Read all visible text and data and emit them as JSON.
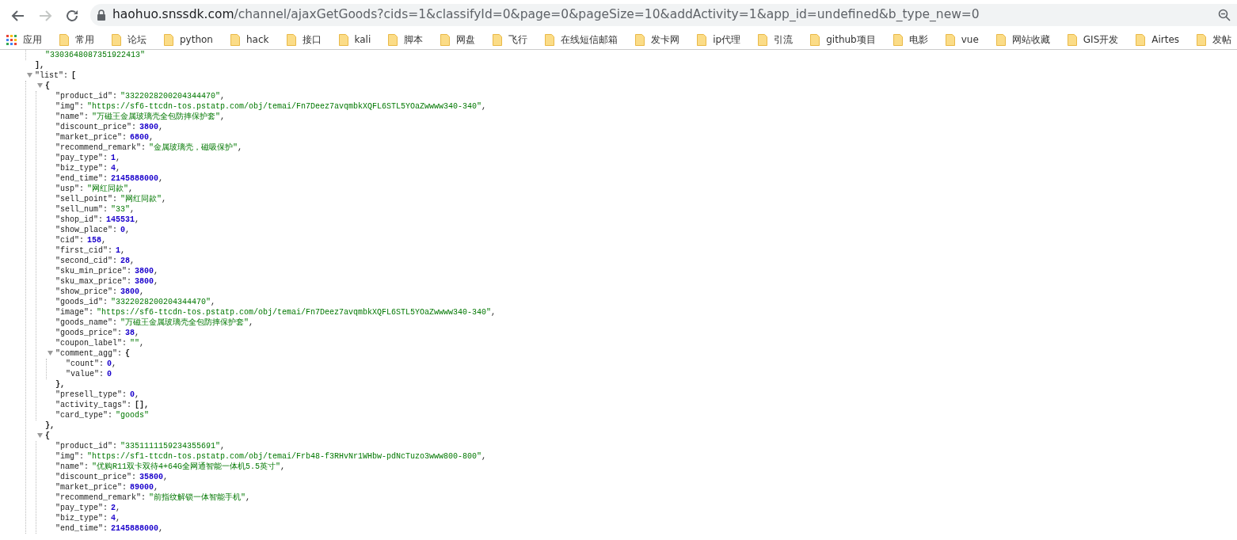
{
  "toolbar": {
    "address_host": "haohuo.snssdk.com",
    "address_path": "/channel/ajaxGetGoods?cids=1&classifyId=0&page=0&pageSize=10&addActivity=1&app_id=undefined&b_type_new=0"
  },
  "bookmarks": [
    {
      "label": "应用",
      "kind": "apps"
    },
    {
      "label": "常用",
      "kind": "folder"
    },
    {
      "label": "论坛",
      "kind": "folder"
    },
    {
      "label": "python",
      "kind": "folder"
    },
    {
      "label": "hack",
      "kind": "folder"
    },
    {
      "label": "接口",
      "kind": "folder"
    },
    {
      "label": "kali",
      "kind": "folder"
    },
    {
      "label": "脚本",
      "kind": "folder"
    },
    {
      "label": "网盘",
      "kind": "folder"
    },
    {
      "label": "飞行",
      "kind": "folder"
    },
    {
      "label": "在线短信邮箱",
      "kind": "folder"
    },
    {
      "label": "发卡网",
      "kind": "folder"
    },
    {
      "label": "ip代理",
      "kind": "folder"
    },
    {
      "label": "引流",
      "kind": "folder"
    },
    {
      "label": "github项目",
      "kind": "folder"
    },
    {
      "label": "电影",
      "kind": "folder"
    },
    {
      "label": "vue",
      "kind": "folder"
    },
    {
      "label": "网站收藏",
      "kind": "folder"
    },
    {
      "label": "GIS开发",
      "kind": "folder"
    },
    {
      "label": "Airtes",
      "kind": "folder"
    },
    {
      "label": "发帖",
      "kind": "folder"
    }
  ],
  "json_view": {
    "lines": [
      {
        "children": [
          {
            "value": "\"3303648087351922413\"",
            "kind": "string"
          }
        ],
        "close": "],"
      },
      {
        "key": "\"list\":",
        "value": "[",
        "kind": "bracket",
        "expanded": true,
        "children": [
          {
            "value": "{",
            "kind": "bracket",
            "expanded": true,
            "close": "},",
            "children": [
              {
                "key": "\"product_id\":",
                "value": "\"3322028200204344470\"",
                "kind": "string",
                "punct": ","
              },
              {
                "key": "\"img\":",
                "value": "\"https://sf6-ttcdn-tos.pstatp.com/obj/temai/Fn7Deez7avqmbkXQFL6STL5YOaZwwww340-340\"",
                "kind": "string",
                "punct": ","
              },
              {
                "key": "\"name\":",
                "value": "\"万磁王金属玻璃壳全包防摔保护套\"",
                "kind": "string",
                "punct": ","
              },
              {
                "key": "\"discount_price\":",
                "value": "3800",
                "kind": "number",
                "punct": ","
              },
              {
                "key": "\"market_price\":",
                "value": "6800",
                "kind": "number",
                "punct": ","
              },
              {
                "key": "\"recommend_remark\":",
                "value": "\"金属玻璃壳，磁吸保护\"",
                "kind": "string",
                "punct": ","
              },
              {
                "key": "\"pay_type\":",
                "value": "1",
                "kind": "number",
                "punct": ","
              },
              {
                "key": "\"biz_type\":",
                "value": "4",
                "kind": "number",
                "punct": ","
              },
              {
                "key": "\"end_time\":",
                "value": "2145888000",
                "kind": "number",
                "punct": ","
              },
              {
                "key": "\"usp\":",
                "value": "\"网红同款\"",
                "kind": "string",
                "punct": ","
              },
              {
                "key": "\"sell_point\":",
                "value": "\"网红同款\"",
                "kind": "string",
                "punct": ","
              },
              {
                "key": "\"sell_num\":",
                "value": "\"33\"",
                "kind": "string",
                "punct": ","
              },
              {
                "key": "\"shop_id\":",
                "value": "145531",
                "kind": "number",
                "punct": ","
              },
              {
                "key": "\"show_place\":",
                "value": "0",
                "kind": "number",
                "punct": ","
              },
              {
                "key": "\"cid\":",
                "value": "158",
                "kind": "number",
                "punct": ","
              },
              {
                "key": "\"first_cid\":",
                "value": "1",
                "kind": "number",
                "punct": ","
              },
              {
                "key": "\"second_cid\":",
                "value": "28",
                "kind": "number",
                "punct": ","
              },
              {
                "key": "\"sku_min_price\":",
                "value": "3800",
                "kind": "number",
                "punct": ","
              },
              {
                "key": "\"sku_max_price\":",
                "value": "3800",
                "kind": "number",
                "punct": ","
              },
              {
                "key": "\"show_price\":",
                "value": "3800",
                "kind": "number",
                "punct": ","
              },
              {
                "key": "\"goods_id\":",
                "value": "\"3322028200204344470\"",
                "kind": "string",
                "punct": ","
              },
              {
                "key": "\"image\":",
                "value": "\"https://sf6-ttcdn-tos.pstatp.com/obj/temai/Fn7Deez7avqmbkXQFL6STL5YOaZwwww340-340\"",
                "kind": "string",
                "punct": ","
              },
              {
                "key": "\"goods_name\":",
                "value": "\"万磁王金属玻璃壳全包防摔保护套\"",
                "kind": "string",
                "punct": ","
              },
              {
                "key": "\"goods_price\":",
                "value": "38",
                "kind": "number",
                "punct": ","
              },
              {
                "key": "\"coupon_label\":",
                "value": "\"\"",
                "kind": "string",
                "punct": ","
              },
              {
                "key": "\"comment_agg\":",
                "value": "{",
                "kind": "bracket",
                "expanded": true,
                "close": "},",
                "children": [
                  {
                    "key": "\"count\":",
                    "value": "0",
                    "kind": "number",
                    "punct": ","
                  },
                  {
                    "key": "\"value\":",
                    "value": "0",
                    "kind": "number"
                  }
                ]
              },
              {
                "key": "\"presell_type\":",
                "value": "0",
                "kind": "number",
                "punct": ","
              },
              {
                "key": "\"activity_tags\":",
                "value": "[],",
                "kind": "bracket"
              },
              {
                "key": "\"card_type\":",
                "value": "\"goods\"",
                "kind": "string"
              }
            ]
          },
          {
            "value": "{",
            "kind": "bracket",
            "expanded": true,
            "children": [
              {
                "key": "\"product_id\":",
                "value": "\"3351111159234355691\"",
                "kind": "string",
                "punct": ","
              },
              {
                "key": "\"img\":",
                "value": "\"https://sf1-ttcdn-tos.pstatp.com/obj/temai/Frb48-f3RHvNr1WHbw-pdNcTuzo3www800-800\"",
                "kind": "string",
                "punct": ","
              },
              {
                "key": "\"name\":",
                "value": "\"优购R11双卡双待4+64G全网通智能一体机5.5英寸\"",
                "kind": "string",
                "punct": ","
              },
              {
                "key": "\"discount_price\":",
                "value": "35800",
                "kind": "number",
                "punct": ","
              },
              {
                "key": "\"market_price\":",
                "value": "89000",
                "kind": "number",
                "punct": ","
              },
              {
                "key": "\"recommend_remark\":",
                "value": "\"前指纹解锁一体智能手机\"",
                "kind": "string",
                "punct": ","
              },
              {
                "key": "\"pay_type\":",
                "value": "2",
                "kind": "number",
                "punct": ","
              },
              {
                "key": "\"biz_type\":",
                "value": "4",
                "kind": "number",
                "punct": ","
              },
              {
                "key": "\"end_time\":",
                "value": "2145888000",
                "kind": "number",
                "punct": ","
              }
            ]
          }
        ]
      }
    ]
  }
}
